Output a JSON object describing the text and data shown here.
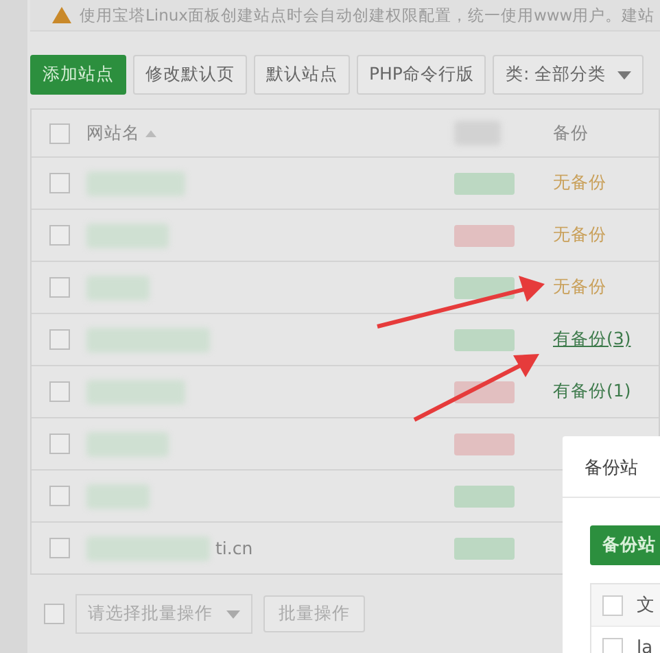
{
  "notice": {
    "text": "使用宝塔Linux面板创建站点时会自动创建权限配置，统一使用www用户。建站"
  },
  "toolbar": {
    "buttons": [
      {
        "label": "添加站点",
        "kind": "primary"
      },
      {
        "label": "修改默认页",
        "kind": "default"
      },
      {
        "label": "默认站点",
        "kind": "default"
      },
      {
        "label": "PHP命令行版",
        "kind": "default"
      }
    ],
    "category_filter": {
      "label": "类: 全部分类"
    }
  },
  "table": {
    "header_checked": false,
    "columns": [
      {
        "label": "网站名",
        "sorted": true
      },
      {
        "label": "备份",
        "sorted": false
      }
    ],
    "rows": [
      {
        "checked": false,
        "color": "#bcd8c2",
        "backup": {
          "text": "无备份",
          "available": false,
          "underlined": false
        }
      },
      {
        "checked": false,
        "color": "#e2bfc0",
        "backup": {
          "text": "无备份",
          "available": false,
          "underlined": false
        }
      },
      {
        "checked": false,
        "color": "#bcd8c2",
        "backup": {
          "text": "无备份",
          "available": false,
          "underlined": false
        }
      },
      {
        "checked": false,
        "color": "#bcd8c2",
        "backup": {
          "text": "有备份(3)",
          "available": true,
          "underlined": true
        }
      },
      {
        "checked": false,
        "color": "#e2bfc0",
        "backup": {
          "text": "有备份(1)",
          "available": true,
          "underlined": false
        }
      },
      {
        "checked": false,
        "color": "#e2bfc0"
      },
      {
        "checked": false,
        "color": "#bcd8c2"
      },
      {
        "checked": false,
        "color": "#bcd8c2",
        "name": "ti.cn"
      }
    ]
  },
  "footer": {
    "checked": false,
    "batch_select": {
      "placeholder": "请选择批量操作"
    },
    "batch_button": "批量操作"
  },
  "dialog": {
    "title": "备份站",
    "button": "备份站",
    "header_checked": false,
    "column": "文",
    "rows": [
      {
        "checked": false,
        "cell": "la"
      }
    ]
  }
}
